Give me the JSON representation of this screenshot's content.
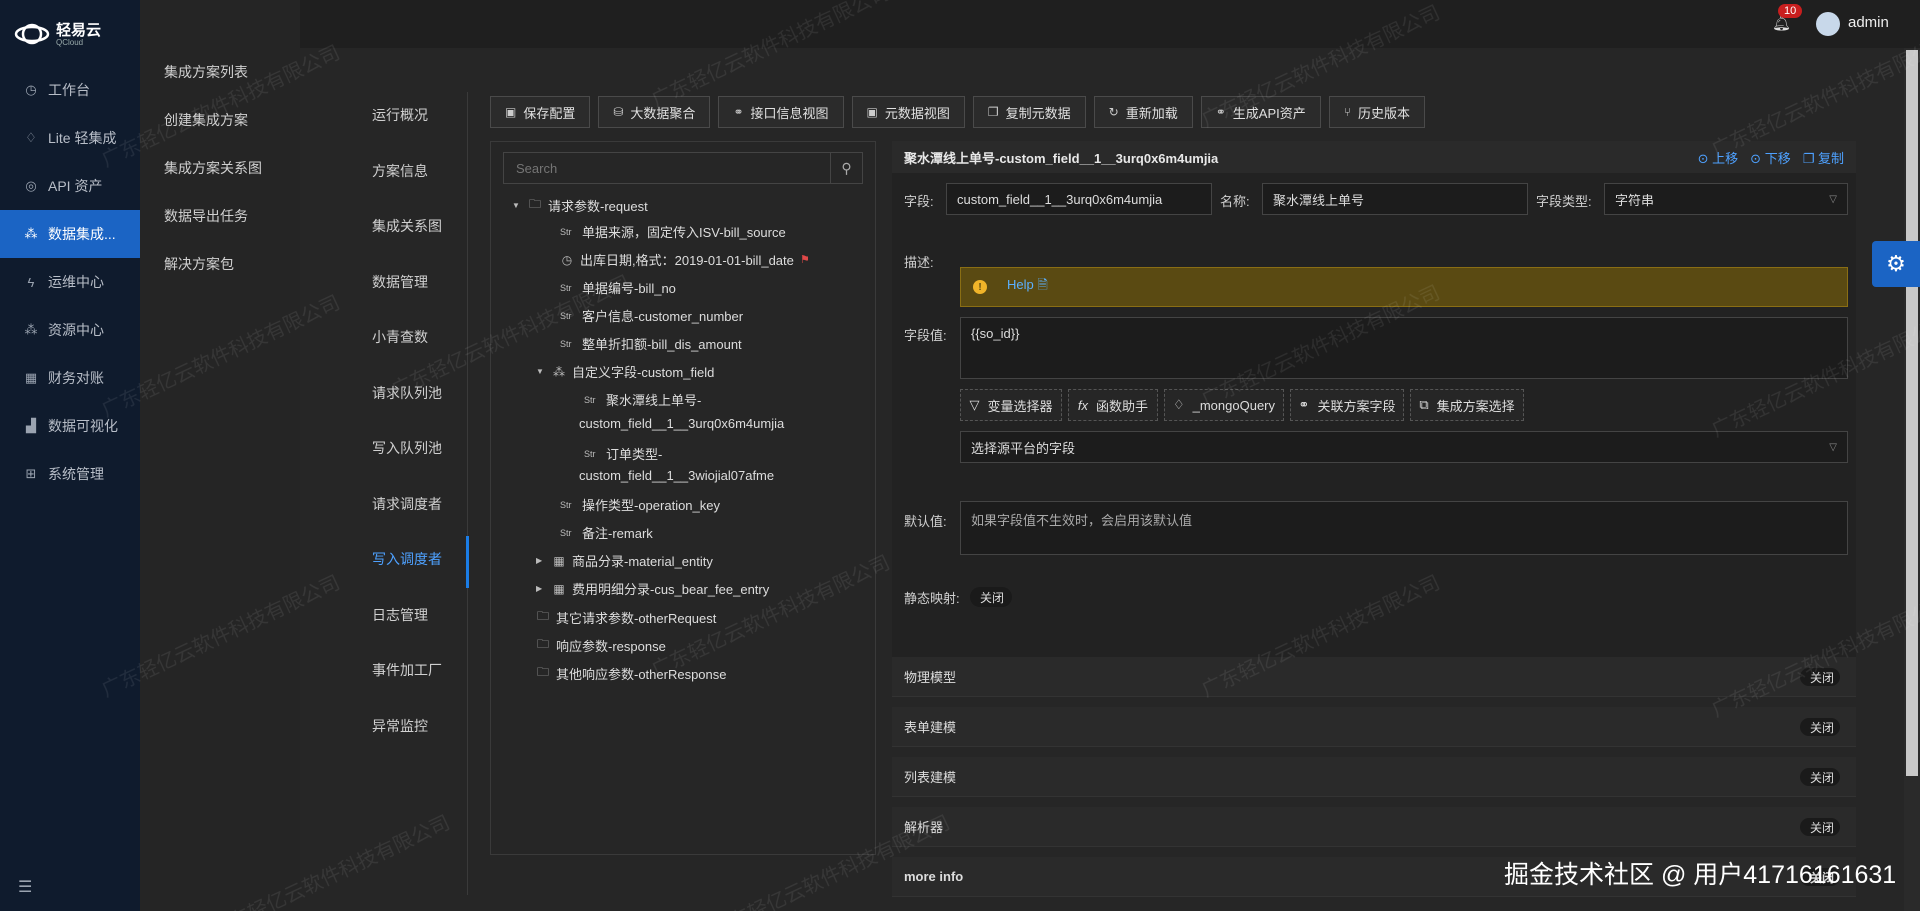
{
  "brand": {
    "name": "轻易云",
    "sub": "QCloud"
  },
  "nav": {
    "items": [
      {
        "label": "工作台",
        "icon": "clock-icon",
        "glyph": "◷"
      },
      {
        "label": "Lite 轻集成",
        "icon": "bulb-icon",
        "glyph": "♢"
      },
      {
        "label": "API 资产",
        "icon": "compass-icon",
        "glyph": "◎"
      },
      {
        "label": "数据集成...",
        "icon": "integration-icon",
        "glyph": "⁂"
      },
      {
        "label": "运维中心",
        "icon": "bolt-icon",
        "glyph": "ϟ"
      },
      {
        "label": "资源中心",
        "icon": "cluster-icon",
        "glyph": "⁂"
      },
      {
        "label": "财务对账",
        "icon": "calculator-icon",
        "glyph": "▦"
      },
      {
        "label": "数据可视化",
        "icon": "chart-icon",
        "glyph": "▟"
      },
      {
        "label": "系统管理",
        "icon": "grid-icon",
        "glyph": "⊞"
      }
    ]
  },
  "submenu": {
    "items": [
      "集成方案列表",
      "创建集成方案",
      "集成方案关系图",
      "数据导出任务",
      "解决方案包"
    ]
  },
  "topbar": {
    "notifications": "10",
    "user": "admin"
  },
  "tabs": [
    "运行概况",
    "方案信息",
    "集成关系图",
    "数据管理",
    "小青查数",
    "请求队列池",
    "写入队列池",
    "请求调度者",
    "写入调度者",
    "日志管理",
    "事件加工厂",
    "异常监控"
  ],
  "toolbar": [
    {
      "label": "保存配置",
      "icon": "save-icon",
      "glyph": "▣"
    },
    {
      "label": "大数据聚合",
      "icon": "database-icon",
      "glyph": "⛁"
    },
    {
      "label": "接口信息视图",
      "icon": "link-icon",
      "glyph": "⚭"
    },
    {
      "label": "元数据视图",
      "icon": "code-icon",
      "glyph": "▣"
    },
    {
      "label": "复制元数据",
      "icon": "copy-icon",
      "glyph": "❐"
    },
    {
      "label": "重新加载",
      "icon": "reload-icon",
      "glyph": "↻"
    },
    {
      "label": "生成API资产",
      "icon": "link-icon",
      "glyph": "⚭"
    },
    {
      "label": "历史版本",
      "icon": "branch-icon",
      "glyph": "⑂"
    }
  ],
  "tree": {
    "search_placeholder": "Search",
    "nodes": {
      "request": "请求参数-request",
      "bill_source": "单据来源，固定传入ISV-bill_source",
      "bill_date": "出库日期,格式：2019-01-01-bill_date",
      "bill_no": "单据编号-bill_no",
      "customer_number": "客户信息-customer_number",
      "bill_dis_amount": "整单折扣额-bill_dis_amount",
      "custom_field": "自定义字段-custom_field",
      "cf1_line1": "聚水潭线上单号-",
      "cf1_line2": "custom_field__1__3urq0x6m4umjia",
      "cf2_line1": "订单类型-",
      "cf2_line2": "custom_field__1__3wiojial07afme",
      "operation_key": "操作类型-operation_key",
      "remark": "备注-remark",
      "material_entity": "商品分录-material_entity",
      "cus_bear_fee_entry": "费用明细分录-cus_bear_fee_entry",
      "otherRequest": "其它请求参数-otherRequest",
      "response": "响应参数-response",
      "otherResponse": "其他响应参数-otherResponse",
      "str_tag": "Str"
    }
  },
  "detail": {
    "title": "聚水潭线上单号-custom_field__1__3urq0x6m4umjia",
    "actions": {
      "up": "上移",
      "down": "下移",
      "copy": "复制"
    },
    "field_label": "字段:",
    "field_value": "custom_field__1__3urq0x6m4umjia",
    "name_label": "名称:",
    "name_value": "聚水潭线上单号",
    "type_label": "字段类型:",
    "type_value": "字符串",
    "desc_label": "描述:",
    "help_text": "Help",
    "value_label": "字段值:",
    "value_text": "{{so_id}}",
    "buttons": {
      "var": "变量选择器",
      "func": "函数助手",
      "mongo": "_mongoQuery",
      "related": "关联方案字段",
      "scheme": "集成方案选择"
    },
    "source_placeholder": "选择源平台的字段",
    "default_label": "默认值:",
    "default_placeholder": "如果字段值不生效时，会启用该默认值",
    "static_label": "静态映射:",
    "static_state": "关闭",
    "sections": [
      {
        "label": "物理模型",
        "state": "关闭"
      },
      {
        "label": "表单建模",
        "state": "关闭"
      },
      {
        "label": "列表建模",
        "state": "关闭"
      },
      {
        "label": "解析器",
        "state": "关闭"
      },
      {
        "label": "more info",
        "state": "关闭"
      }
    ]
  },
  "watermark": "广东轻亿云软件科技有限公司",
  "footer_credit": "掘金技术社区 @ 用户41716161631"
}
